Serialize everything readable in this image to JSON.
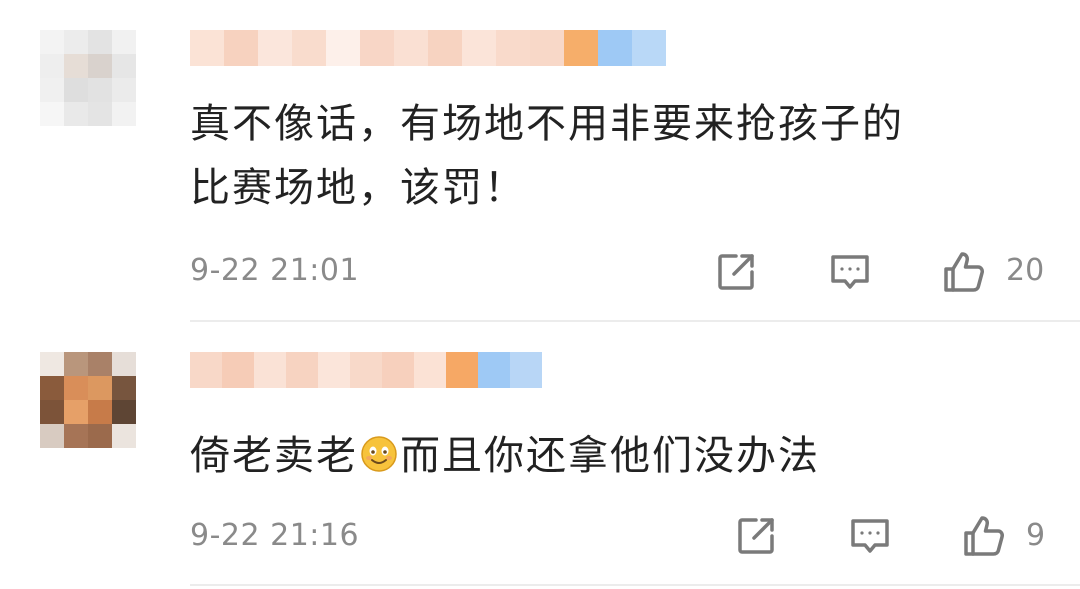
{
  "comments": [
    {
      "text_line1": "真不像话，有场地不用非要来抢孩子的",
      "text_line2": "比赛场地，该罚！",
      "time": "9-22 21:01",
      "like_count": "20"
    },
    {
      "text_before_emoji": "倚老卖老",
      "emoji_name": "smiling-face-emoji",
      "text_after_emoji": "而且你还拿他们没办法",
      "time": "9-22 21:16",
      "like_count": "9"
    }
  ],
  "icons": {
    "share": "share-icon",
    "reply": "comment-icon",
    "like": "thumbs-up-icon"
  },
  "colors": {
    "text": "#222222",
    "meta": "#8a8a8a",
    "icon": "#7a7a7a",
    "divider": "#ececec",
    "background": "#ffffff"
  }
}
